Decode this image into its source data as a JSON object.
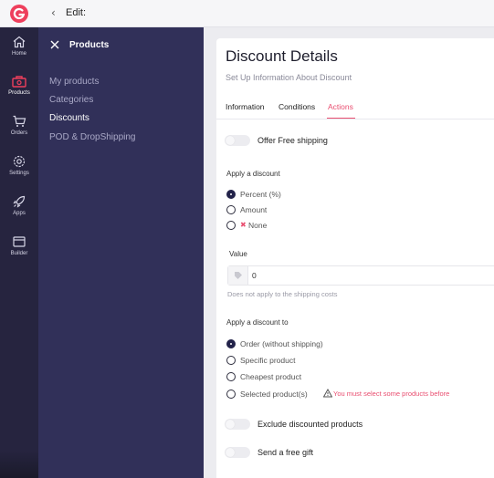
{
  "header": {
    "back_icon": "chevron-left-icon",
    "title": "Edit:"
  },
  "rail": {
    "items": [
      {
        "label": "Home",
        "icon": "home-icon"
      },
      {
        "label": "Products",
        "icon": "products-icon"
      },
      {
        "label": "Orders",
        "icon": "cart-icon"
      },
      {
        "label": "Settings",
        "icon": "gear-icon"
      },
      {
        "label": "Apps",
        "icon": "rocket-icon"
      },
      {
        "label": "Builder",
        "icon": "browser-icon"
      }
    ]
  },
  "nav": {
    "title": "Products",
    "items": [
      {
        "label": "My products"
      },
      {
        "label": "Categories"
      },
      {
        "label": "Discounts"
      },
      {
        "label": "POD & DropShipping"
      }
    ]
  },
  "card": {
    "title": "Discount Details",
    "subtitle": "Set Up Information About Discount",
    "tabs": [
      {
        "label": "Information"
      },
      {
        "label": "Conditions"
      },
      {
        "label": "Actions"
      }
    ],
    "free_shipping": {
      "label": "Offer Free shipping",
      "on": false
    },
    "apply_discount": {
      "label": "Apply a discount",
      "options": [
        {
          "label": "Percent (%)",
          "checked": true
        },
        {
          "label": "Amount",
          "checked": false
        },
        {
          "label": "None",
          "checked": false
        }
      ]
    },
    "value": {
      "label": "Value",
      "value": "0",
      "hint": "Does not apply to the shipping costs"
    },
    "apply_to": {
      "label": "Apply a discount to",
      "options": [
        {
          "label": "Order (without shipping)",
          "checked": true
        },
        {
          "label": "Specific product",
          "checked": false
        },
        {
          "label": "Cheapest product",
          "checked": false
        },
        {
          "label": "Selected product(s)",
          "checked": false
        }
      ],
      "warning": "You must select some products before"
    },
    "exclude_discounted": {
      "label": "Exclude discounted products",
      "on": false
    },
    "free_gift": {
      "label": "Send a free gift",
      "on": false
    }
  },
  "colors": {
    "accent": "#e94e70",
    "nav_bg": "#313059",
    "rail_bg": "#26243f",
    "logo": "#ee3f5c"
  }
}
